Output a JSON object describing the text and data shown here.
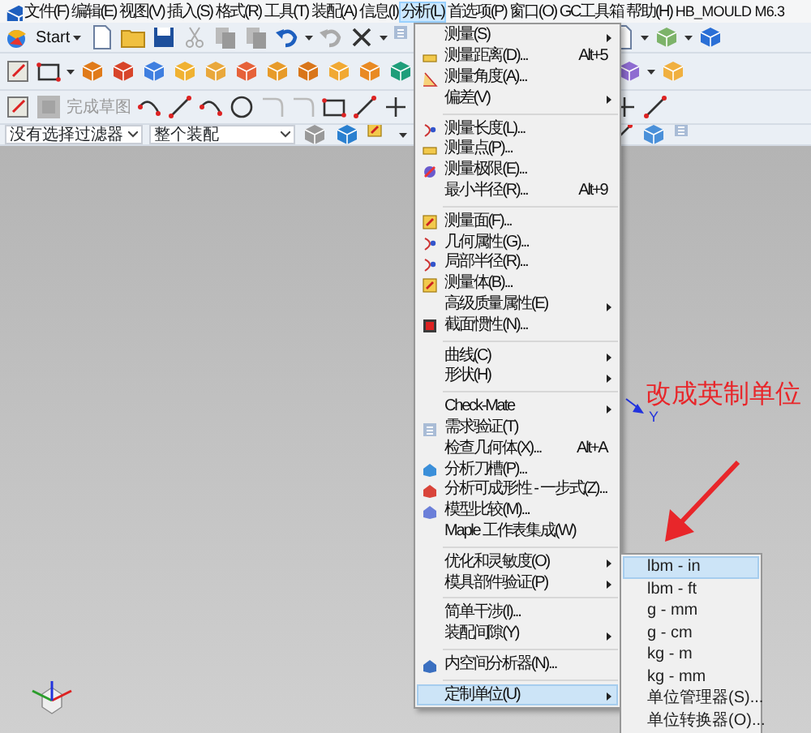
{
  "menu_bar": [
    {
      "label": "文件(F)",
      "selected": false
    },
    {
      "label": "编辑(E)",
      "selected": false
    },
    {
      "label": "视图(V)",
      "selected": false
    },
    {
      "label": "插入(S)",
      "selected": false
    },
    {
      "label": "格式(R)",
      "selected": false
    },
    {
      "label": "工具(T)",
      "selected": false
    },
    {
      "label": "装配(A)",
      "selected": false
    },
    {
      "label": "信息(I)",
      "selected": false
    },
    {
      "label": "分析(L)",
      "selected": true
    },
    {
      "label": "首选项(P)",
      "selected": false
    },
    {
      "label": "窗口(O)",
      "selected": false
    },
    {
      "label": "GC工具箱",
      "selected": false
    },
    {
      "label": "帮助(H)",
      "selected": false
    },
    {
      "label": "HB_MOULD M6.3",
      "selected": false
    }
  ],
  "toolbar": {
    "start_button": "Start",
    "finish_sketch": {
      "label": "完成草图",
      "disabled": true
    },
    "filter_combo": "没有选择过滤器",
    "scope_combo": "整个装配"
  },
  "menu": {
    "groups": [
      [
        {
          "label": "测量(S)",
          "submenu": true,
          "selected": false
        },
        {
          "label": "测量距离(D)...",
          "shortcut": "Alt+5",
          "submenu": false,
          "selected": false
        },
        {
          "label": "测量角度(A)...",
          "submenu": false,
          "selected": false
        },
        {
          "label": "偏差(V)",
          "submenu": true,
          "selected": false
        }
      ],
      [
        {
          "label": "测量长度(L)...",
          "submenu": false,
          "selected": false
        },
        {
          "label": "测量点(P)...",
          "submenu": false,
          "selected": false
        },
        {
          "label": "测量极限(E)...",
          "submenu": false,
          "selected": false
        },
        {
          "label": "最小半径(R)...",
          "shortcut": "Alt+9",
          "submenu": false,
          "selected": false
        }
      ],
      [
        {
          "label": "测量面(F)...",
          "submenu": false,
          "selected": false
        },
        {
          "label": "几何属性(G)...",
          "submenu": false,
          "selected": false
        },
        {
          "label": "局部半径(R)...",
          "submenu": false,
          "selected": false
        },
        {
          "label": "测量体(B)...",
          "submenu": false,
          "selected": false
        },
        {
          "label": "高级质量属性(E)",
          "submenu": true,
          "selected": false
        },
        {
          "label": "截面惯性(N)...",
          "submenu": false,
          "selected": false
        }
      ],
      [
        {
          "label": "曲线(C)",
          "submenu": true,
          "selected": false
        },
        {
          "label": "形状(H)",
          "submenu": true,
          "selected": false
        }
      ],
      [
        {
          "label": "Check-Mate",
          "submenu": true,
          "selected": false
        },
        {
          "label": "需求验证(T)",
          "submenu": false,
          "selected": false
        },
        {
          "label": "检查几何体(X)...",
          "shortcut": "Alt+A",
          "submenu": false,
          "selected": false
        },
        {
          "label": "分析刀槽(P)...",
          "submenu": false,
          "selected": false
        },
        {
          "label": "分析可成形性 - 一步式(Z)...",
          "submenu": false,
          "selected": false
        },
        {
          "label": "模型比较(M)...",
          "submenu": false,
          "selected": false
        },
        {
          "label": "Maple 工作表集成(W)",
          "submenu": false,
          "selected": false
        }
      ],
      [
        {
          "label": "优化和灵敏度(O)",
          "submenu": true,
          "selected": false
        },
        {
          "label": "模具部件验证(P)",
          "submenu": true,
          "selected": false
        }
      ],
      [
        {
          "label": "简单干涉(I)...",
          "submenu": false,
          "selected": false
        },
        {
          "label": "装配间隙(Y)",
          "submenu": true,
          "selected": false
        }
      ],
      [
        {
          "label": "内空间分析器(N)...",
          "submenu": false,
          "selected": false
        }
      ],
      [
        {
          "label": "定制单位(U)",
          "submenu": true,
          "selected": true
        }
      ]
    ]
  },
  "submenu": {
    "items": [
      {
        "label": "lbm - in",
        "selected": true
      },
      {
        "label": "lbm - ft",
        "selected": false
      },
      {
        "label": "g - mm",
        "selected": false
      },
      {
        "label": "g - cm",
        "selected": false
      },
      {
        "label": "kg - m",
        "selected": false
      },
      {
        "label": "kg - mm",
        "selected": false
      },
      {
        "label": "单位管理器(S)...",
        "selected": false
      },
      {
        "label": "单位转换器(O)...",
        "selected": false
      }
    ]
  },
  "graphics": {
    "axis_label": "Y",
    "annotation": "改成英制单位"
  }
}
